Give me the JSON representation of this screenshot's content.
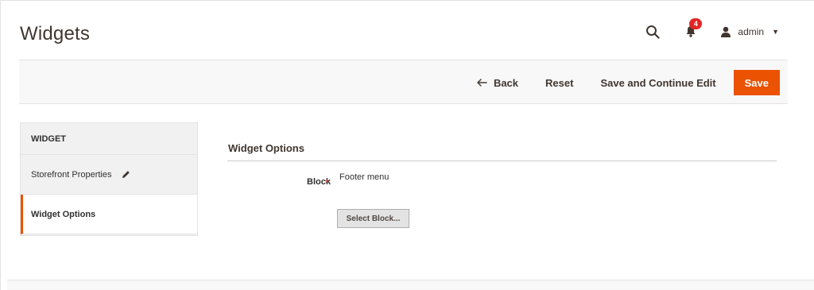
{
  "header": {
    "title": "Widgets",
    "notifications_count": "4",
    "user_name": "admin",
    "icons": {
      "search": "search-icon",
      "notifications": "bell-icon",
      "user": "user-icon",
      "caret": "chevron-down-icon"
    }
  },
  "toolbar": {
    "back_label": "Back",
    "reset_label": "Reset",
    "save_continue_label": "Save and Continue Edit",
    "save_label": "Save"
  },
  "sidebar": {
    "title": "WIDGET",
    "items": [
      {
        "label": "Storefront Properties",
        "icon": "pencil-icon"
      },
      {
        "label": "Widget Options",
        "active": true
      }
    ]
  },
  "main": {
    "section_title": "Widget Options",
    "block_label": "Block",
    "block_value": "Footer menu",
    "select_block_label": "Select Block..."
  },
  "colors": {
    "accent": "#eb5202",
    "badge": "#e22626",
    "toolbar_bg": "#f8f8f8",
    "sidebar_bg": "#f1f1f1"
  }
}
